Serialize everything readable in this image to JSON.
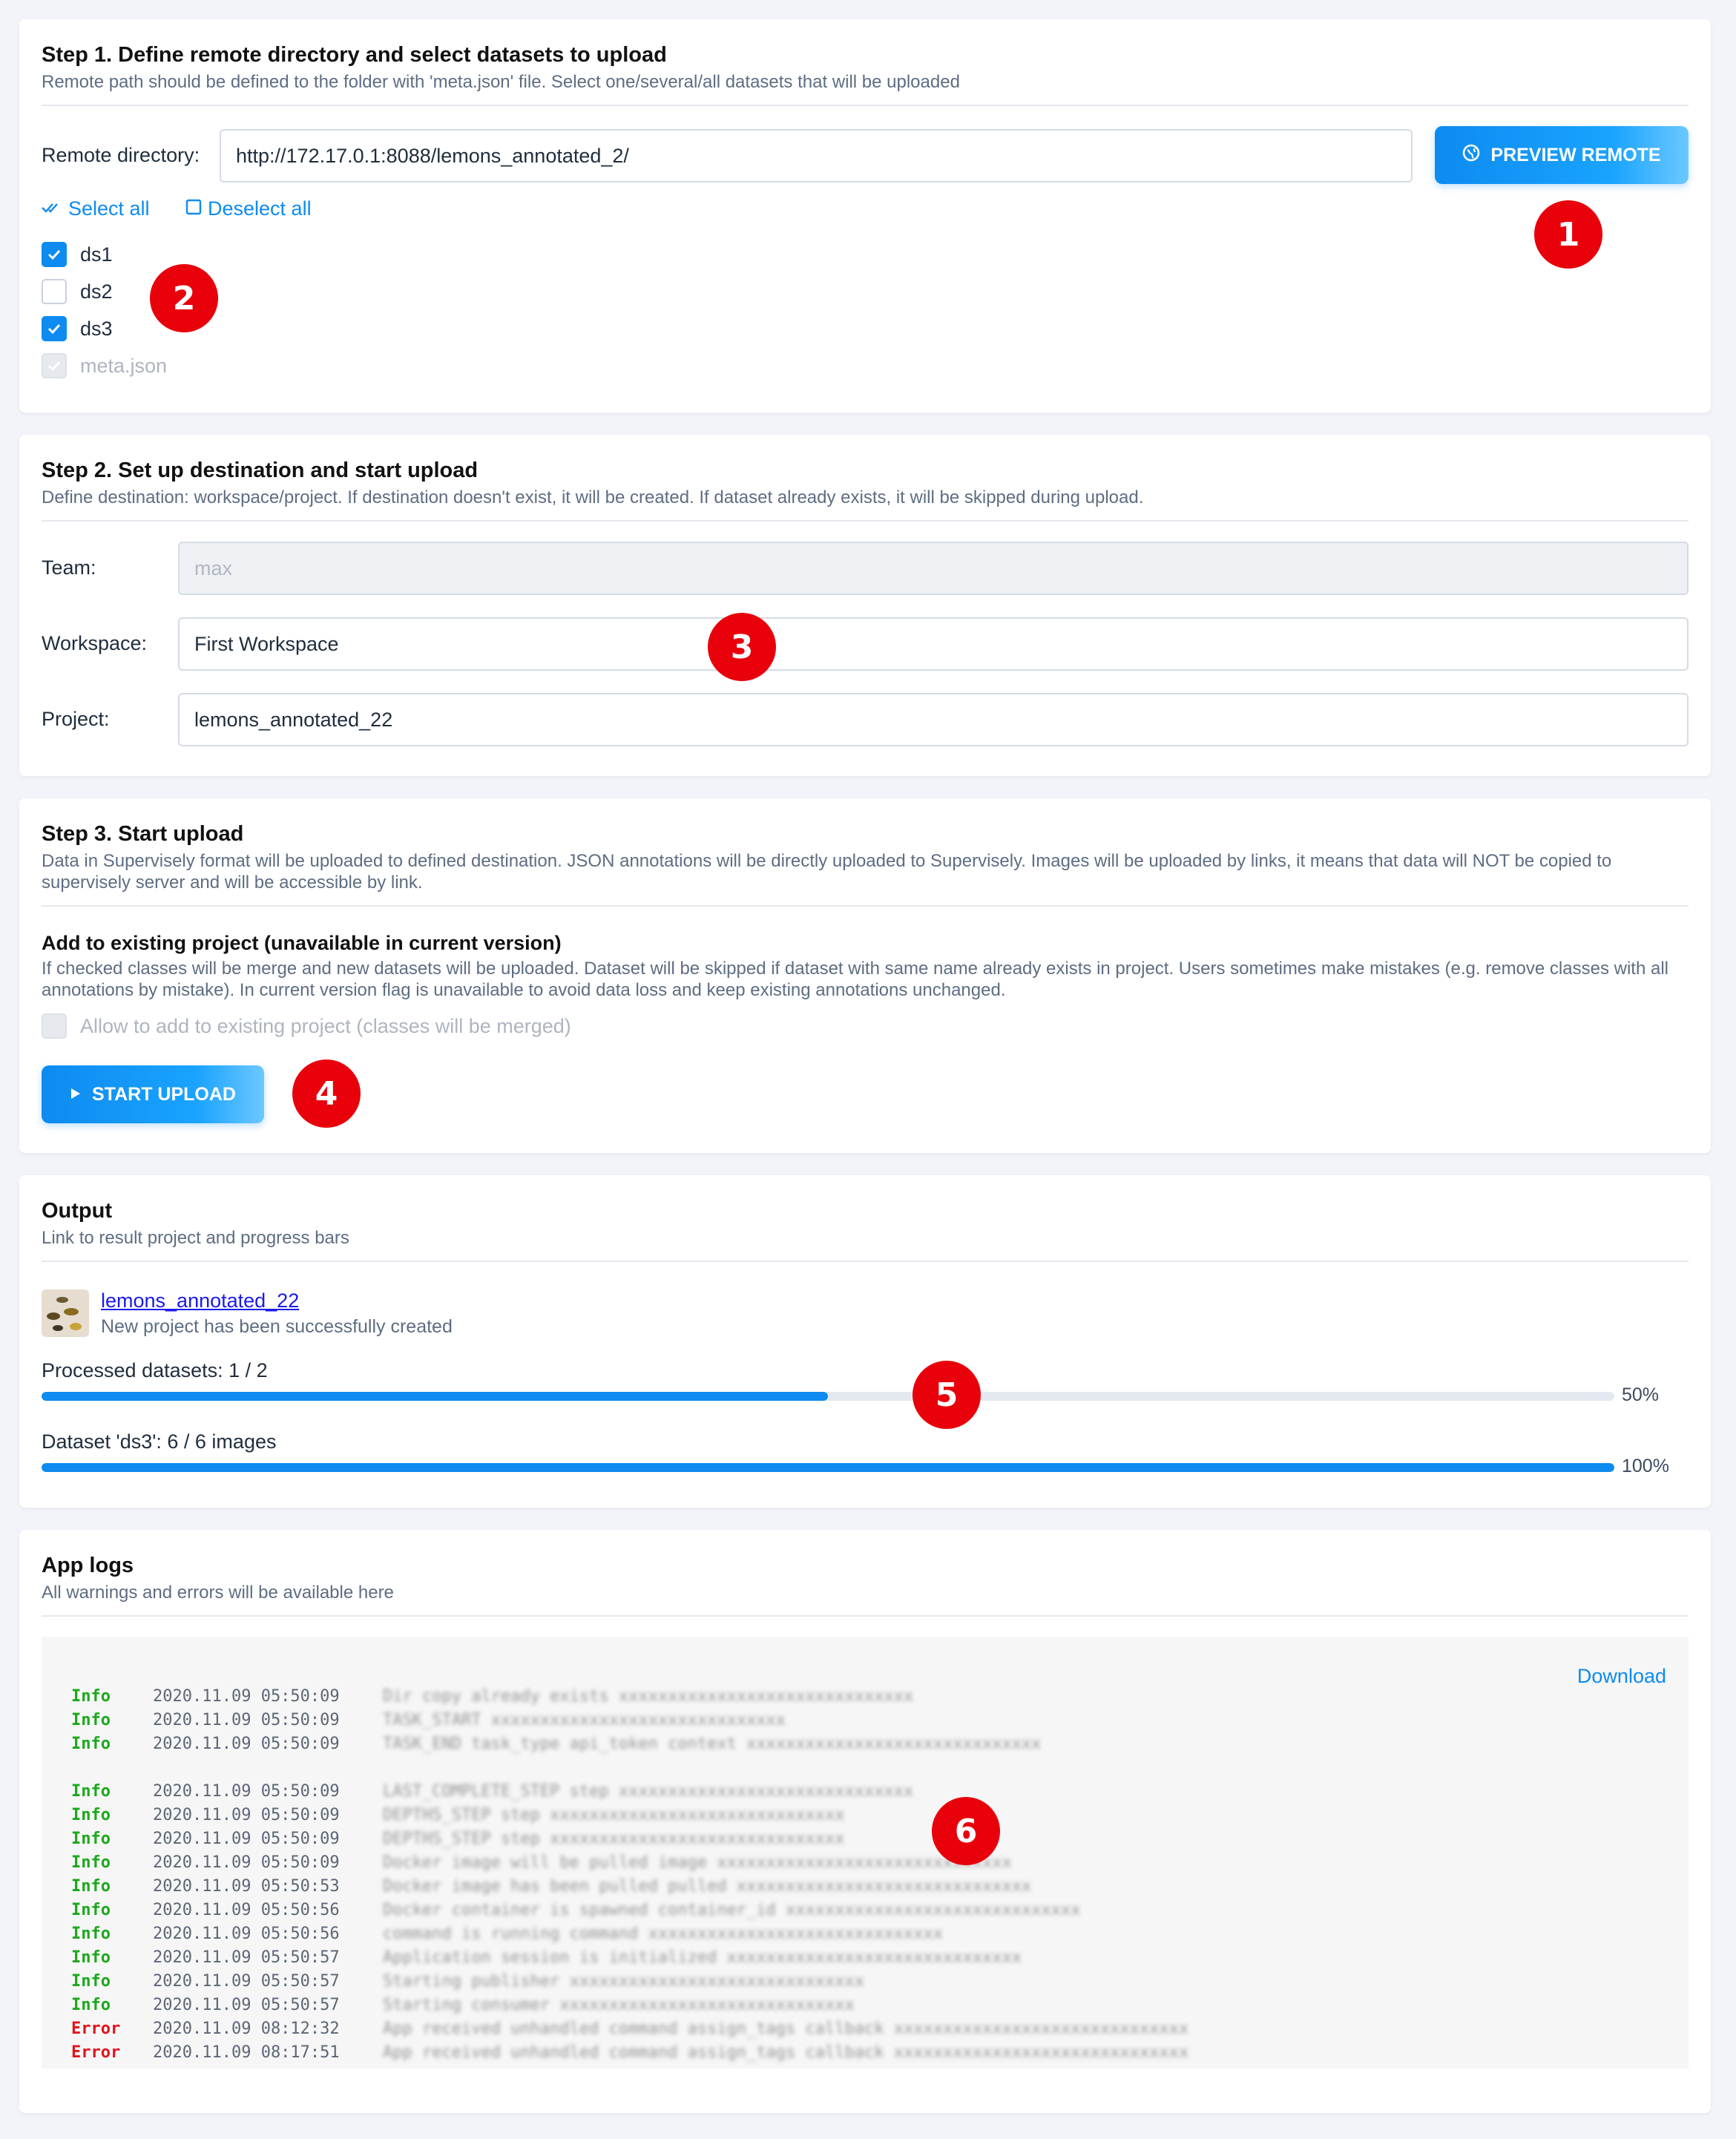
{
  "step1": {
    "title": "Step 1. Define remote directory and select datasets to upload",
    "description": "Remote path should be defined to the folder with 'meta.json' file. Select one/several/all datasets that will be uploaded",
    "remote_label": "Remote directory:",
    "remote_value": "http://172.17.0.1:8088/lemons_annotated_2/",
    "preview_button": "PREVIEW REMOTE",
    "select_all": "Select all",
    "deselect_all": "Deselect all",
    "datasets": [
      {
        "label": "ds1",
        "checked": true
      },
      {
        "label": "ds2",
        "checked": false
      },
      {
        "label": "ds3",
        "checked": true
      },
      {
        "label": "meta.json",
        "checked": true,
        "disabled": true
      }
    ]
  },
  "step2": {
    "title": "Step 2. Set up destination and start upload",
    "description": "Define destination: workspace/project. If destination doesn't exist, it will be created. If dataset already exists, it will be skipped during upload.",
    "team_label": "Team:",
    "team_value": "max",
    "workspace_label": "Workspace:",
    "workspace_value": "First Workspace",
    "project_label": "Project:",
    "project_value": "lemons_annotated_22"
  },
  "step3": {
    "title": "Step 3. Start upload",
    "description": "Data in Supervisely format will be uploaded to defined destination. JSON annotations will be directly uploaded to Supervisely. Images will be uploaded by links, it means that data will NOT be copied to supervisely server and will be accessible by link.",
    "add_title": "Add to existing project (unavailable in current version)",
    "add_description": "If checked classes will be merge and new datasets will be uploaded. Dataset will be skipped if dataset with same name already exists in project. Users sometimes make mistakes (e.g. remove classes with all annotations by mistake). In current version flag is unavailable to avoid data loss and keep existing annotations unchanged.",
    "allow_label": "Allow to add to existing project (classes will be merged)",
    "start_button": "START UPLOAD"
  },
  "output": {
    "title": "Output",
    "description": "Link to result project and progress bars",
    "project_link": "lemons_annotated_22",
    "project_status": "New project has been successfully created",
    "progress1_label": "Processed datasets: 1 / 2",
    "progress1_value": 0.5,
    "progress1_pct": "50%",
    "progress2_label": "Dataset 'ds3': 6 / 6 images",
    "progress2_value": 1.0,
    "progress2_pct": "100%"
  },
  "logs": {
    "title": "App logs",
    "description": "All warnings and errors will be available here",
    "download": "Download",
    "lines": [
      {
        "level": "Info",
        "time": "2020.11.09 05:50:09"
      },
      {
        "level": "Info",
        "time": "2020.11.09 05:50:09"
      },
      {
        "level": "Info",
        "time": "2020.11.09 05:50:09"
      },
      {
        "level": "Info",
        "time": "2020.11.09 05:50:09"
      },
      {
        "level": "Info",
        "time": "2020.11.09 05:50:09"
      },
      {
        "level": "Info",
        "time": "2020.11.09 05:50:09"
      },
      {
        "level": "Info",
        "time": "2020.11.09 05:50:09"
      },
      {
        "level": "Info",
        "time": "2020.11.09 05:50:53"
      },
      {
        "level": "Info",
        "time": "2020.11.09 05:50:56"
      },
      {
        "level": "Info",
        "time": "2020.11.09 05:50:56"
      },
      {
        "level": "Info",
        "time": "2020.11.09 05:50:57"
      },
      {
        "level": "Info",
        "time": "2020.11.09 05:50:57"
      },
      {
        "level": "Info",
        "time": "2020.11.09 05:50:57"
      },
      {
        "level": "Error",
        "time": "2020.11.09 08:12:32"
      },
      {
        "level": "Error",
        "time": "2020.11.09 08:17:51"
      }
    ]
  },
  "badges": [
    "1",
    "2",
    "3",
    "4",
    "5",
    "6"
  ],
  "colors": {
    "accent": "#0d8bf0",
    "badge": "#e8000b",
    "info": "#1ca81c",
    "error": "#e0141e"
  }
}
